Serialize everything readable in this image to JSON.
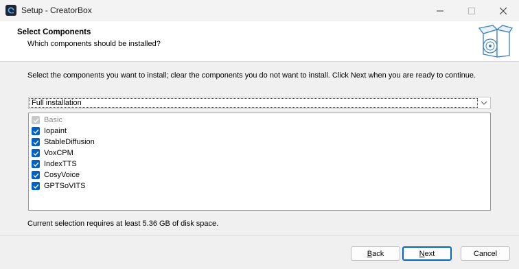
{
  "window": {
    "title": "Setup - CreatorBox"
  },
  "header": {
    "title": "Select Components",
    "subtitle": "Which components should be installed?"
  },
  "main": {
    "instructions": "Select the components you want to install; clear the components you do not want to install. Click Next when you are ready to continue.",
    "install_type": {
      "selected": "Full installation"
    },
    "components": [
      {
        "label": "Basic",
        "checked": true,
        "disabled": true
      },
      {
        "label": "Iopaint",
        "checked": true,
        "disabled": false
      },
      {
        "label": "StableDiffusion",
        "checked": true,
        "disabled": false
      },
      {
        "label": "VoxCPM",
        "checked": true,
        "disabled": false
      },
      {
        "label": "IndexTTS",
        "checked": true,
        "disabled": false
      },
      {
        "label": "CosyVoice",
        "checked": true,
        "disabled": false
      },
      {
        "label": "GPTSoVITS",
        "checked": true,
        "disabled": false
      }
    ],
    "disk_space": "Current selection requires at least 5.36 GB of disk space."
  },
  "buttons": {
    "back_accel": "B",
    "back_rest": "ack",
    "next_accel": "N",
    "next_rest": "ext",
    "cancel": "Cancel"
  },
  "colors": {
    "accent": "#0060c0",
    "disabled_check": "#c8c8c8"
  }
}
